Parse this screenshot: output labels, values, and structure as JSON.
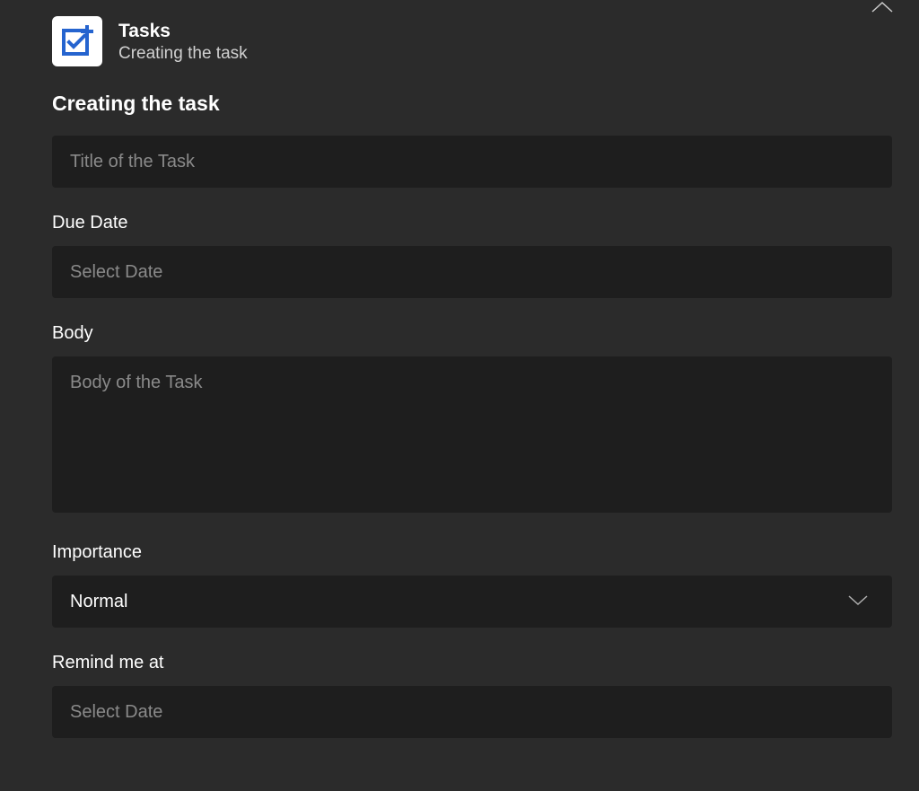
{
  "header": {
    "app_title": "Tasks",
    "app_subtitle": "Creating the task"
  },
  "form": {
    "section_title": "Creating the task",
    "title": {
      "placeholder": "Title of the Task",
      "value": ""
    },
    "due_date": {
      "label": "Due Date",
      "placeholder": "Select Date",
      "value": ""
    },
    "body": {
      "label": "Body",
      "placeholder": "Body of the Task",
      "value": ""
    },
    "importance": {
      "label": "Importance",
      "selected": "Normal"
    },
    "remind": {
      "label": "Remind me at",
      "placeholder": "Select Date",
      "value": ""
    }
  }
}
